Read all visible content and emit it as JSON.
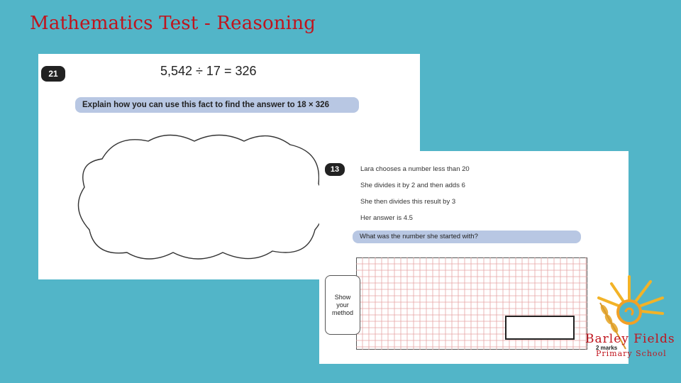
{
  "slide": {
    "title": "Mathematics Test - Reasoning"
  },
  "q21": {
    "number": "21",
    "fact": "5,542  ÷  17  =  326",
    "prompt": "Explain how you can use this fact to find the answer to 18 × 326"
  },
  "q13": {
    "number": "13",
    "lines": [
      "Lara chooses a number less than 20",
      "She divides it by 2 and then adds 6",
      "She then divides this result by 3",
      "Her answer is 4.5"
    ],
    "prompt": "What was the number she started with?",
    "method_label": [
      "Show",
      "your",
      "method"
    ],
    "marks": "2 marks"
  },
  "logo": {
    "line1": "Barley Fields",
    "line2": "Primary School",
    "icon": "sun-wheat-logo"
  },
  "colors": {
    "background": "#52b5c8",
    "title": "#c0141d",
    "prompt_band": "#b8c7e3",
    "grid": "#e6a5a5"
  }
}
